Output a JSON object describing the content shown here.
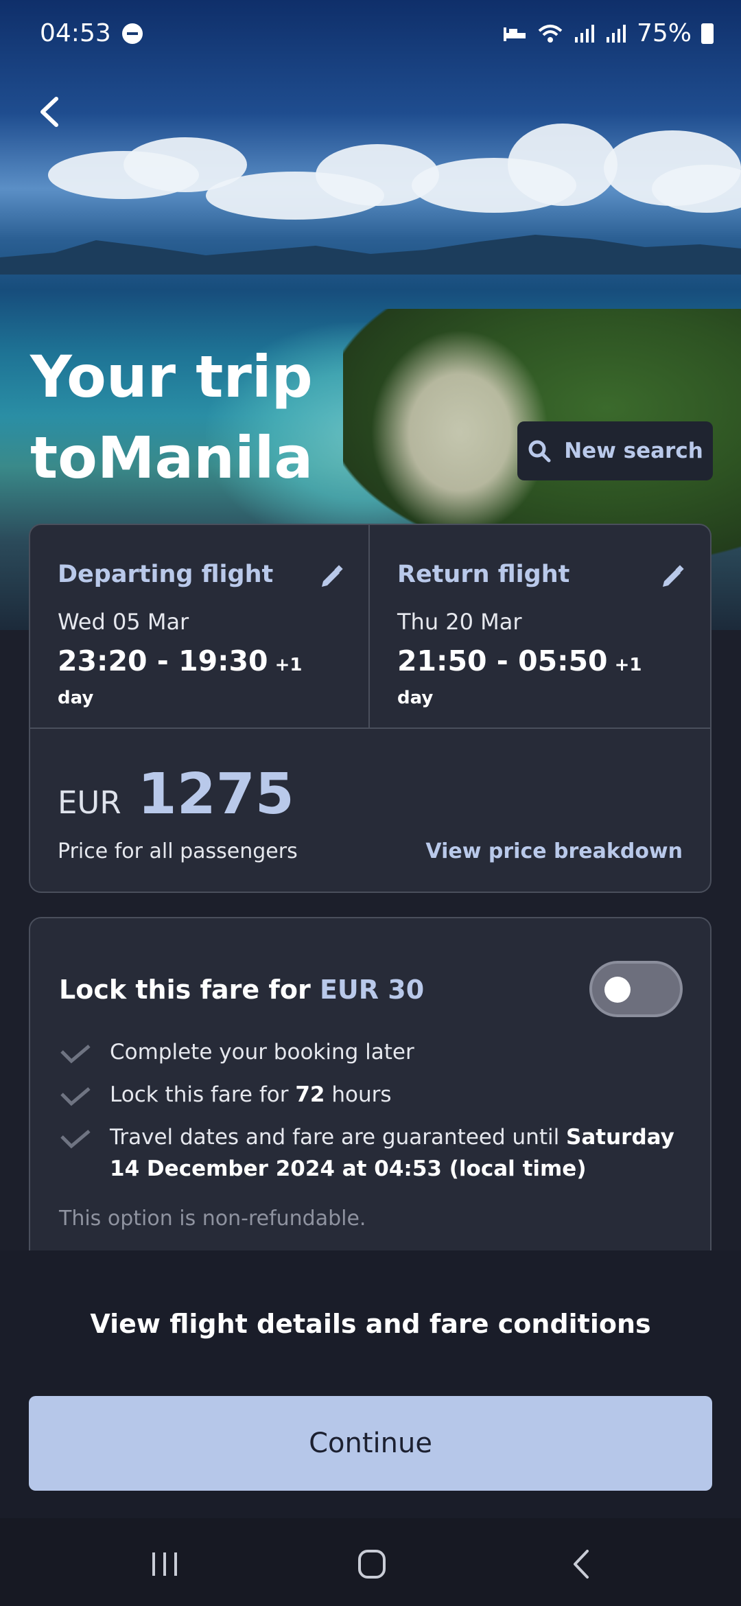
{
  "status_bar": {
    "time": "04:53",
    "battery": "75%"
  },
  "hero": {
    "title_line1": "Your trip",
    "title_line2": "toManila",
    "new_search_label": "New search"
  },
  "departing": {
    "label": "Departing flight",
    "date": "Wed 05 Mar",
    "times": "23:20 - 19:30",
    "plus_day": "+1 day"
  },
  "return": {
    "label": "Return flight",
    "date": "Thu 20 Mar",
    "times": "21:50 - 05:50",
    "plus_day": "+1 day"
  },
  "price": {
    "currency": "EUR",
    "amount": "1275",
    "note": "Price for all passengers",
    "breakdown_link": "View price breakdown"
  },
  "lock": {
    "title_prefix": "Lock this fare for ",
    "title_price": "EUR 30",
    "toggle_on": false,
    "benefit1": "Complete your booking later",
    "benefit2_prefix": "Lock this fare for ",
    "benefit2_bold": "72",
    "benefit2_suffix": " hours",
    "benefit3_prefix": "Travel dates and fare are guaranteed until ",
    "benefit3_bold": "Saturday 14 December 2024 at 04:53 (local time)",
    "non_refundable": "This option is non-refundable."
  },
  "footer": {
    "details_link": "View flight details and fare conditions",
    "continue_label": "Continue"
  },
  "colors": {
    "accent": "#b9c9ea",
    "background": "#1c1f2b",
    "card": "#272b38",
    "button": "#b6c7e9"
  },
  "icons": [
    "do-not-disturb-icon",
    "sleep-mode-icon",
    "wifi-icon",
    "signal-icon",
    "battery-icon",
    "back-arrow-icon",
    "search-icon",
    "pencil-icon",
    "check-icon",
    "recent-apps-icon",
    "home-icon",
    "nav-back-icon"
  ]
}
